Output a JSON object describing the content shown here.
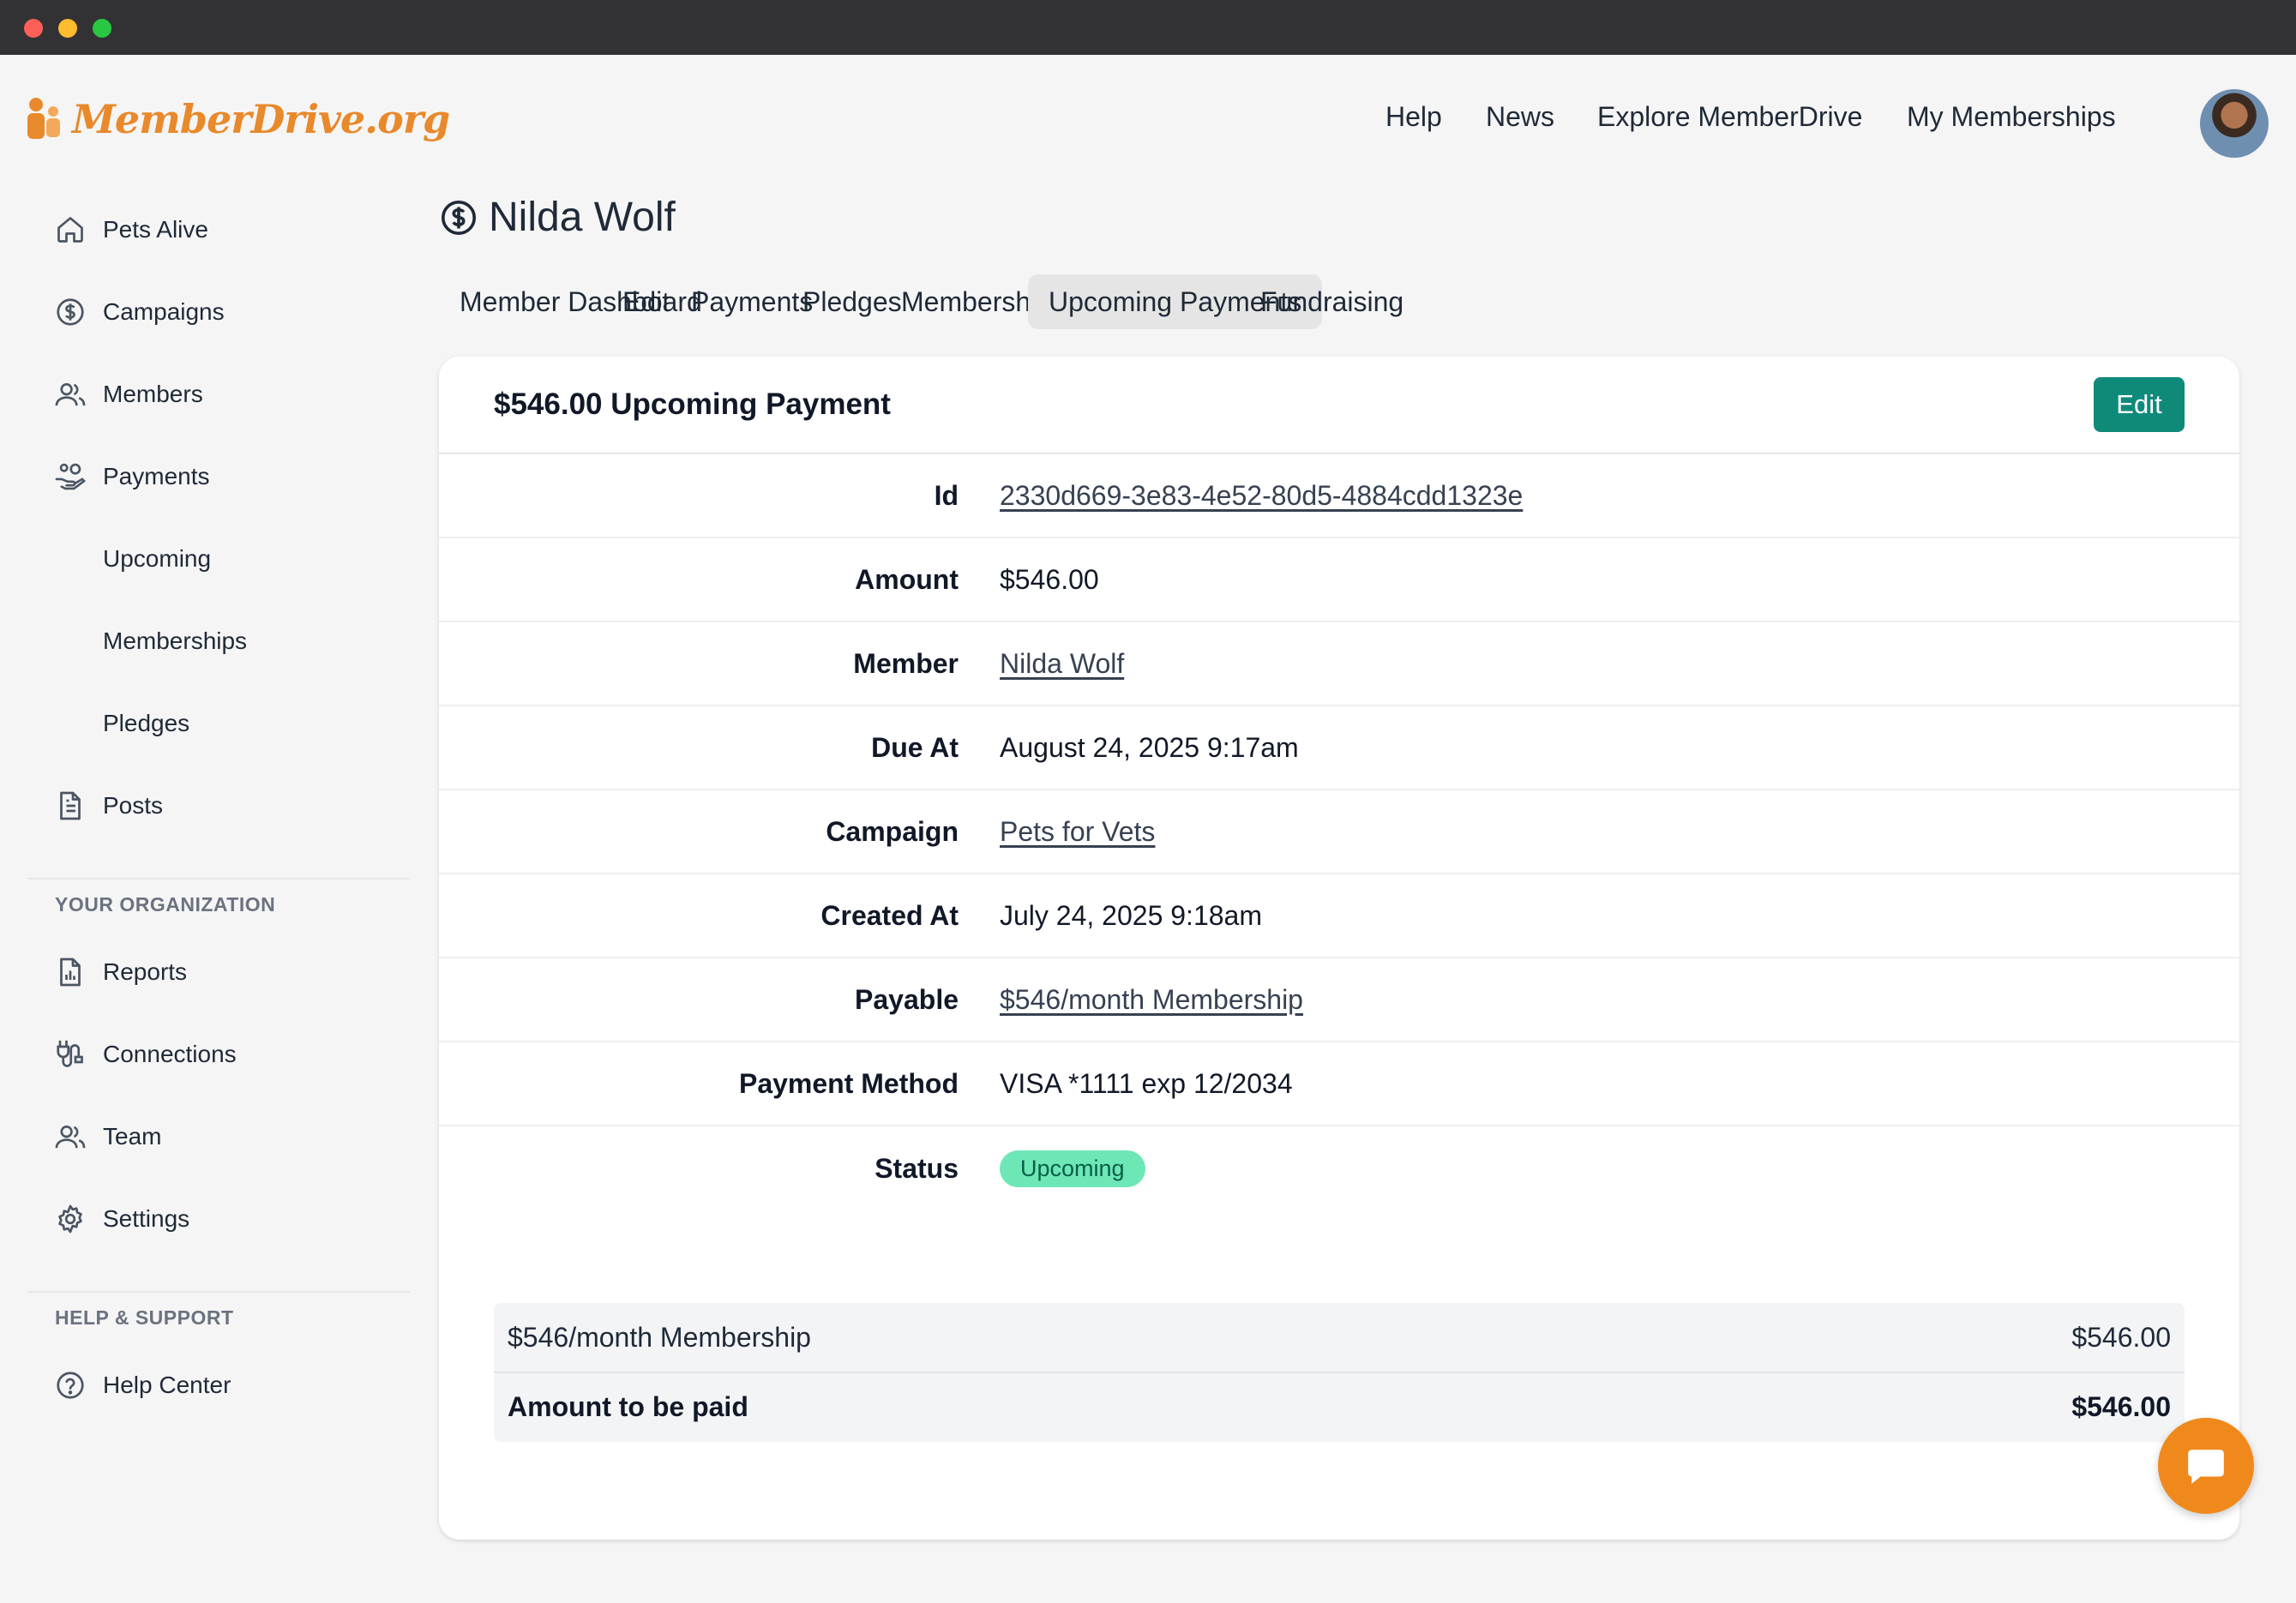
{
  "brand": {
    "logo_text": "MemberDrive.org",
    "accent": "#e8892b"
  },
  "topnav": {
    "links": [
      "Help",
      "News",
      "Explore MemberDrive",
      "My Memberships"
    ]
  },
  "sidebar": {
    "items": [
      {
        "label": "Pets Alive",
        "icon": "home-icon"
      },
      {
        "label": "Campaigns",
        "icon": "dollar-circle-icon"
      },
      {
        "label": "Members",
        "icon": "users-icon"
      },
      {
        "label": "Payments",
        "icon": "hand-coins-icon"
      },
      {
        "label": "Upcoming"
      },
      {
        "label": "Memberships"
      },
      {
        "label": "Pledges"
      },
      {
        "label": "Posts",
        "icon": "document-icon"
      }
    ],
    "org_section": "YOUR ORGANIZATION",
    "org_items": [
      {
        "label": "Reports",
        "icon": "report-icon"
      },
      {
        "label": "Connections",
        "icon": "plug-icon"
      },
      {
        "label": "Team",
        "icon": "users-icon"
      },
      {
        "label": "Settings",
        "icon": "gear-icon"
      }
    ],
    "help_section": "HELP & SUPPORT",
    "help_items": [
      {
        "label": "Help Center",
        "icon": "question-circle-icon"
      }
    ]
  },
  "page": {
    "title": "Nilda Wolf",
    "tabs": [
      "Member Dashboard",
      "Edit",
      "Payments",
      "Pledges",
      "Memberships",
      "Upcoming Payments",
      "Fundraising"
    ],
    "active_tab": "Upcoming Payments"
  },
  "card": {
    "title": "$546.00 Upcoming Payment",
    "edit_label": "Edit",
    "fields": [
      {
        "label": "Id",
        "value": "2330d669-3e83-4e52-80d5-4884cdd1323e",
        "link": true
      },
      {
        "label": "Amount",
        "value": "$546.00",
        "link": false
      },
      {
        "label": "Member",
        "value": "Nilda Wolf",
        "link": true
      },
      {
        "label": "Due At",
        "value": "August 24, 2025 9:17am",
        "link": false
      },
      {
        "label": "Campaign",
        "value": "Pets for Vets",
        "link": true
      },
      {
        "label": "Created At",
        "value": "July 24, 2025 9:18am",
        "link": false
      },
      {
        "label": "Payable",
        "value": "$546/month Membership",
        "link": true
      },
      {
        "label": "Payment Method",
        "value": "VISA *1111 exp 12/2034",
        "link": false
      },
      {
        "label": "Status",
        "value": "Upcoming",
        "badge": true
      }
    ],
    "summary": {
      "line_item": {
        "label": "$546/month Membership",
        "amount": "$546.00"
      },
      "total": {
        "label": "Amount to be paid",
        "amount": "$546.00"
      }
    }
  },
  "colors": {
    "primary_button": "#0f8a7a",
    "status_badge": "#6ee7b7",
    "chat_fab": "#f0891c"
  }
}
